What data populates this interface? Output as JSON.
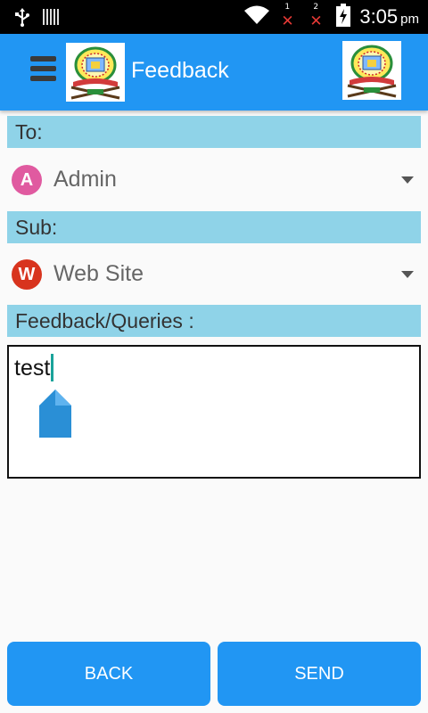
{
  "status_bar": {
    "time": "3:05",
    "time_suffix": "pm",
    "sim1_label": "1",
    "sim2_label": "2",
    "icons": [
      "usb-icon",
      "barcode-icon",
      "wifi-icon",
      "signal-no-service-icon",
      "battery-charging-icon"
    ]
  },
  "app_bar": {
    "title": "Feedback",
    "menu_icon": "hamburger-menu-icon",
    "logo_icon": "emblem-logo-icon"
  },
  "form": {
    "to_label": "To:",
    "to_value": "Admin",
    "to_avatar_letter": "A",
    "sub_label": "Sub:",
    "sub_value": "Web Site",
    "sub_avatar_letter": "W",
    "feedback_label": "Feedback/Queries :",
    "feedback_value": "test"
  },
  "buttons": {
    "back": "BACK",
    "send": "SEND"
  },
  "colors": {
    "primary": "#2196f3",
    "section_header": "#8fd3e8",
    "avatar_admin": "#e05aa0",
    "avatar_web": "#d8341e",
    "cursor": "#1aa39a"
  }
}
